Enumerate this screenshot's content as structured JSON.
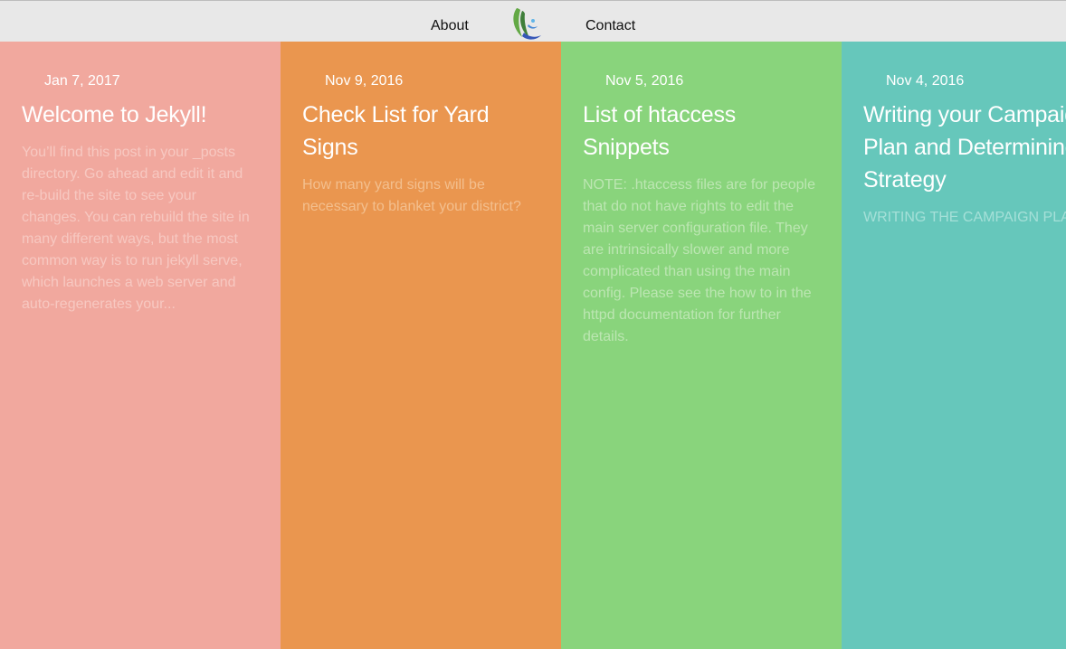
{
  "nav": {
    "about_label": "About",
    "contact_label": "Contact",
    "logo_icon": "leaf-swoosh-logo-icon"
  },
  "posts": [
    {
      "date": "Jan 7, 2017",
      "title": "Welcome to Jekyll!",
      "excerpt": "You’ll find this post in your _posts directory. Go ahead and edit it and re-build the site to see your changes. You can rebuild the site in many different ways, but the most common way is to run jekyll serve, which launches a web server and auto-regenerates your...",
      "background": "#f1a89e",
      "excerpt_color": "#f7c8c1"
    },
    {
      "date": "Nov 9, 2016",
      "title": "Check List for Yard Signs",
      "excerpt": "How many yard signs will be necessary to blanket your district?",
      "background": "#ea964f",
      "excerpt_color": "#f3bf8e"
    },
    {
      "date": "Nov 5, 2016",
      "title": "List of htaccess Snippets",
      "excerpt": "NOTE: .htaccess files are for people that do not have rights to edit the main server configuration file. They are intrinsically slower and more complicated than using the main config. Please see the how to in the httpd documentation for further details.",
      "background": "#89d47c",
      "excerpt_color": "#bce6b2"
    },
    {
      "date": "Nov 4, 2016",
      "title": "Writing your Campaign Plan and Determining the Strategy",
      "excerpt": "WRITING THE CAMPAIGN PLAN",
      "background": "#66c7bb",
      "excerpt_color": "#a5e0d8"
    }
  ]
}
